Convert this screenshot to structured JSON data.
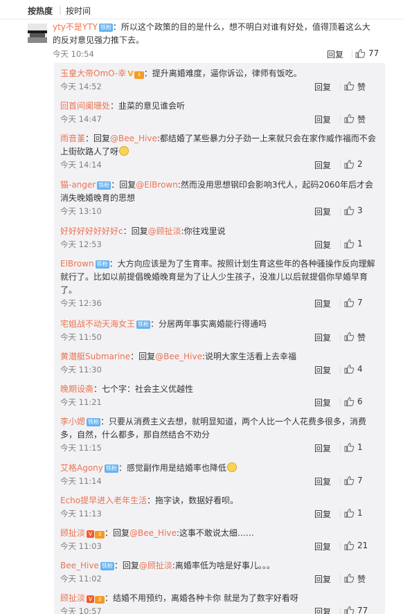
{
  "sort": {
    "hot": "按热度",
    "time": "按时间"
  },
  "main_comment": {
    "user": "yty不是YTY",
    "badge": "铁粉",
    "text": "：所以这个政策的目的是什么，想不明白对谁有好处，值得顶着这么大的反对意见强力推下去。",
    "time": "今天 10:54",
    "reply_label": "回复",
    "likes": "77"
  },
  "replies": [
    {
      "user": "玉皇大帝OmO-幸",
      "badge": "",
      "vip": "gold",
      "level": "3",
      "prefix": "",
      "at": "",
      "text": "：提升离婚难度，逼你诉讼，律师有饭吃。",
      "emoji": false,
      "time": "今天 14:52",
      "reply_label": "回复",
      "likes": "赞"
    },
    {
      "user": "回首间阑珊处",
      "badge": "",
      "vip": "",
      "level": "",
      "prefix": "",
      "at": "",
      "text": "：韭菜的意见谁会听",
      "emoji": false,
      "time": "今天 14:47",
      "reply_label": "回复",
      "likes": "赞"
    },
    {
      "user": "雨音堇",
      "badge": "",
      "vip": "",
      "level": "",
      "prefix": "：回复",
      "at": "@Bee_Hive",
      "text": ":都结婚了某些暴力分子劲一上来就只会在家作威作福而不会上街砍路人了呀",
      "emoji": true,
      "time": "今天 14:14",
      "reply_label": "回复",
      "likes": "2"
    },
    {
      "user": "猫-anger",
      "badge": "铁粉",
      "vip": "",
      "level": "",
      "prefix": "：回复",
      "at": "@ElBrown",
      "text": ":然而没用思想钢印会影响3代人，起码2060年后才会消失晚婚晚育的思想",
      "emoji": false,
      "time": "今天 13:10",
      "reply_label": "回复",
      "likes": "3"
    },
    {
      "user": "好好好好好好好c",
      "badge": "",
      "vip": "",
      "level": "",
      "prefix": "：回复",
      "at": "@顾扯淡",
      "text": ":你往戏里说",
      "emoji": false,
      "time": "今天 12:53",
      "reply_label": "回复",
      "likes": "1"
    },
    {
      "user": "ElBrown",
      "badge": "铁粉",
      "vip": "",
      "level": "",
      "prefix": "",
      "at": "",
      "text": "：大方向应该是为了生育率。按照计划生育这些年的各种骚操作反向理解就行了。比如以前提倡晚婚晚育是为了让人少生孩子，没准儿以后就提倡你早婚早育了。",
      "emoji": false,
      "time": "今天 12:36",
      "reply_label": "回复",
      "likes": "7"
    },
    {
      "user": "宅姐战不动天海女王",
      "badge": "铁粉",
      "vip": "",
      "level": "",
      "prefix": "",
      "at": "",
      "text": "：分居两年事实离婚能行得通吗",
      "emoji": false,
      "time": "今天 11:50",
      "reply_label": "回复",
      "likes": "赞"
    },
    {
      "user": "黄潜艇Submarine",
      "badge": "",
      "vip": "",
      "level": "",
      "prefix": "：回复",
      "at": "@Bee_Hive",
      "text": ":说明大家生活看上去幸福",
      "emoji": false,
      "time": "今天 11:30",
      "reply_label": "回复",
      "likes": "4"
    },
    {
      "user": "晚期设斋",
      "badge": "",
      "vip": "",
      "level": "",
      "prefix": "",
      "at": "",
      "text": "：七个字：社会主义优越性",
      "emoji": false,
      "time": "今天 11:21",
      "reply_label": "回复",
      "likes": "6"
    },
    {
      "user": "李小媤",
      "badge": "铁粉",
      "vip": "",
      "level": "",
      "prefix": "",
      "at": "",
      "text": "：只要从消费主义去想，就明显知道，两个人比一个人花费多很多，消费多，自然，什么都多，那自然结合不劝分",
      "emoji": false,
      "time": "今天 11:15",
      "reply_label": "回复",
      "likes": "1"
    },
    {
      "user": "艾格Agony",
      "badge": "铁粉",
      "vip": "",
      "level": "",
      "prefix": "",
      "at": "",
      "text": "：感觉副作用是结婚率也降低",
      "emoji": true,
      "time": "今天 11:14",
      "reply_label": "回复",
      "likes": "7"
    },
    {
      "user": "Echo提早进入老年生活",
      "badge": "",
      "vip": "",
      "level": "",
      "prefix": "",
      "at": "",
      "text": "：拖字诀，数据好看呗。",
      "emoji": false,
      "time": "今天 11:13",
      "reply_label": "回复",
      "likes": "1"
    },
    {
      "user": "顾扯淡",
      "badge": "",
      "vip": "red",
      "level": "3",
      "prefix": "：回复",
      "at": "@Bee_Hive",
      "text": ":这事不敢说太细……",
      "emoji": false,
      "time": "今天 11:03",
      "reply_label": "回复",
      "likes": "21"
    },
    {
      "user": "Bee_Hive",
      "badge": "铁粉",
      "vip": "",
      "level": "",
      "prefix": "：回复",
      "at": "@顾扯淡",
      "text": ":离婚率低为啥是好事儿。。。",
      "emoji": false,
      "time": "今天 11:02",
      "reply_label": "回复",
      "likes": "赞"
    },
    {
      "user": "顾扯淡",
      "badge": "",
      "vip": "red",
      "level": "3",
      "prefix": "",
      "at": "",
      "text": "：结婚不用预约，离婚各种卡你 就是为了数字好看呀",
      "emoji": false,
      "time": "今天 10:57",
      "reply_label": "回复",
      "likes": "77"
    }
  ]
}
